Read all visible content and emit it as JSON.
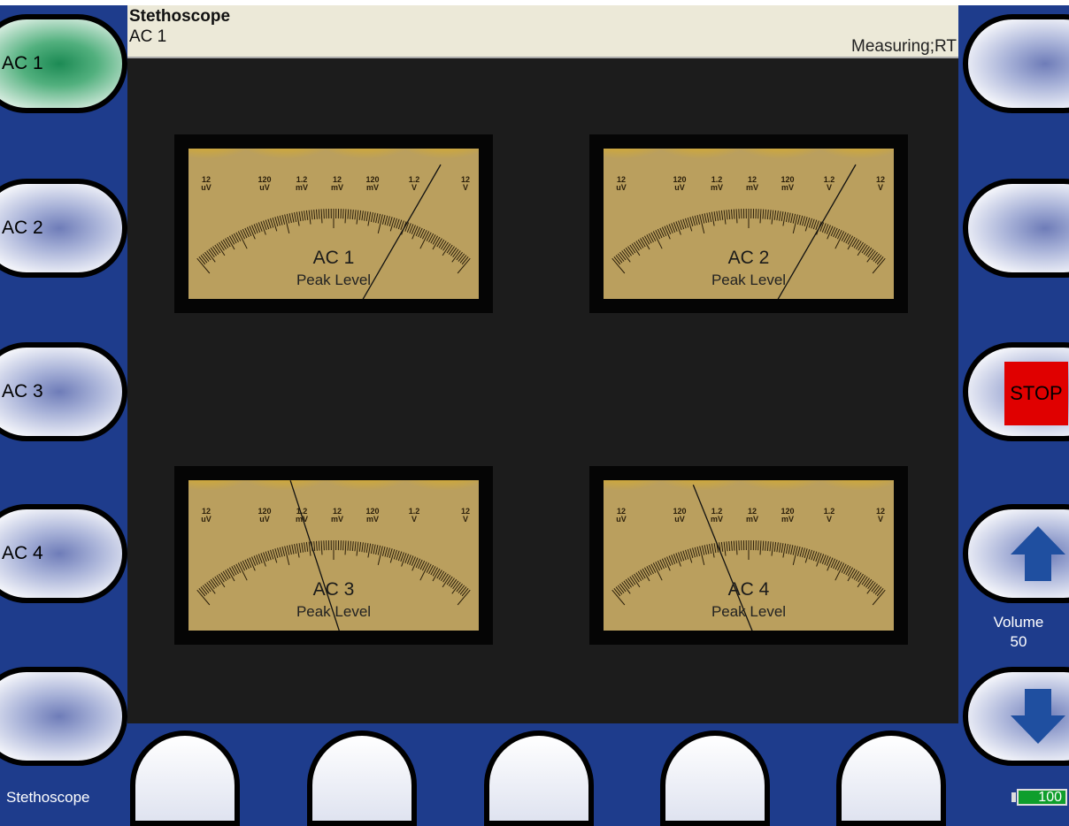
{
  "header": {
    "title": "Stethoscope",
    "channel": "AC 1",
    "status": "Measuring;RT"
  },
  "left_buttons": [
    "AC 1",
    "AC 2",
    "AC 3",
    "AC 4",
    ""
  ],
  "right_buttons": {
    "stop_label": "STOP"
  },
  "volume": {
    "label": "Volume",
    "value": "50"
  },
  "status_bar": {
    "mode": "Stethoscope",
    "battery": "100"
  },
  "scale_labels": [
    [
      "12",
      "uV"
    ],
    [
      "120",
      "uV"
    ],
    [
      "1.2",
      "mV"
    ],
    [
      "12",
      "mV"
    ],
    [
      "120",
      "mV"
    ],
    [
      "1.2",
      "V"
    ],
    [
      "12",
      "V"
    ]
  ],
  "meters": [
    {
      "name": "AC 1",
      "subtitle": "Peak Level",
      "needle_angle_deg": 30
    },
    {
      "name": "AC 2",
      "subtitle": "Peak Level",
      "needle_angle_deg": 30
    },
    {
      "name": "AC 3",
      "subtitle": "Peak Level",
      "needle_angle_deg": -18
    },
    {
      "name": "AC 4",
      "subtitle": "Peak Level",
      "needle_angle_deg": -22
    }
  ],
  "colors": {
    "frame": "#1e3c8c",
    "active_button": "#1c8a54",
    "stop": "#e00000",
    "meter_face": "#ba9f5e",
    "glow": "#f0b800"
  }
}
